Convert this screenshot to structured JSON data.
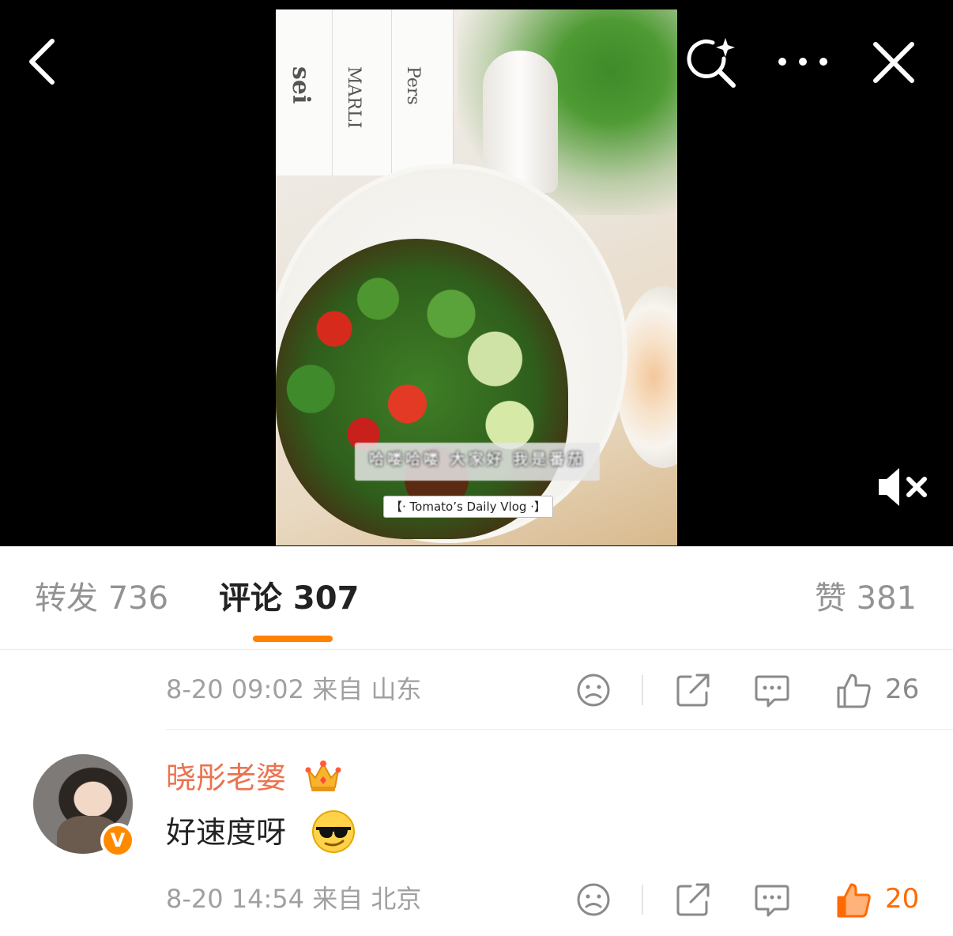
{
  "video": {
    "book_spines": [
      "sei",
      "MARLI",
      "Pers"
    ],
    "subtitle": "哈喽哈喽 大家好 我是番茄",
    "vlog_tag": "【· Tomato’s Daily Vlog ·】"
  },
  "tabs": {
    "repost": "转发 736",
    "comment": "评论 307",
    "like": "赞 381",
    "active": "comment",
    "accent_color": "#ff8200"
  },
  "comments": [
    {
      "meta": "8-20 09:02  来自 山东",
      "like_count": "26",
      "liked": false
    },
    {
      "username": "晓彤老婆",
      "text": "好速度呀",
      "verified_badge": "V",
      "meta": "8-20 14:54  来自 北京",
      "like_count": "20",
      "liked": true
    }
  ],
  "icons": [
    "back-icon",
    "image-search-icon",
    "more-icon",
    "close-icon",
    "mute-icon",
    "dislike-icon",
    "share-icon",
    "reply-icon",
    "like-icon",
    "crown-icon",
    "sunglasses-emoji-icon"
  ],
  "colors": {
    "username": "#eb7350",
    "liked": "#ff6a00",
    "badge": "#ff8a00"
  }
}
